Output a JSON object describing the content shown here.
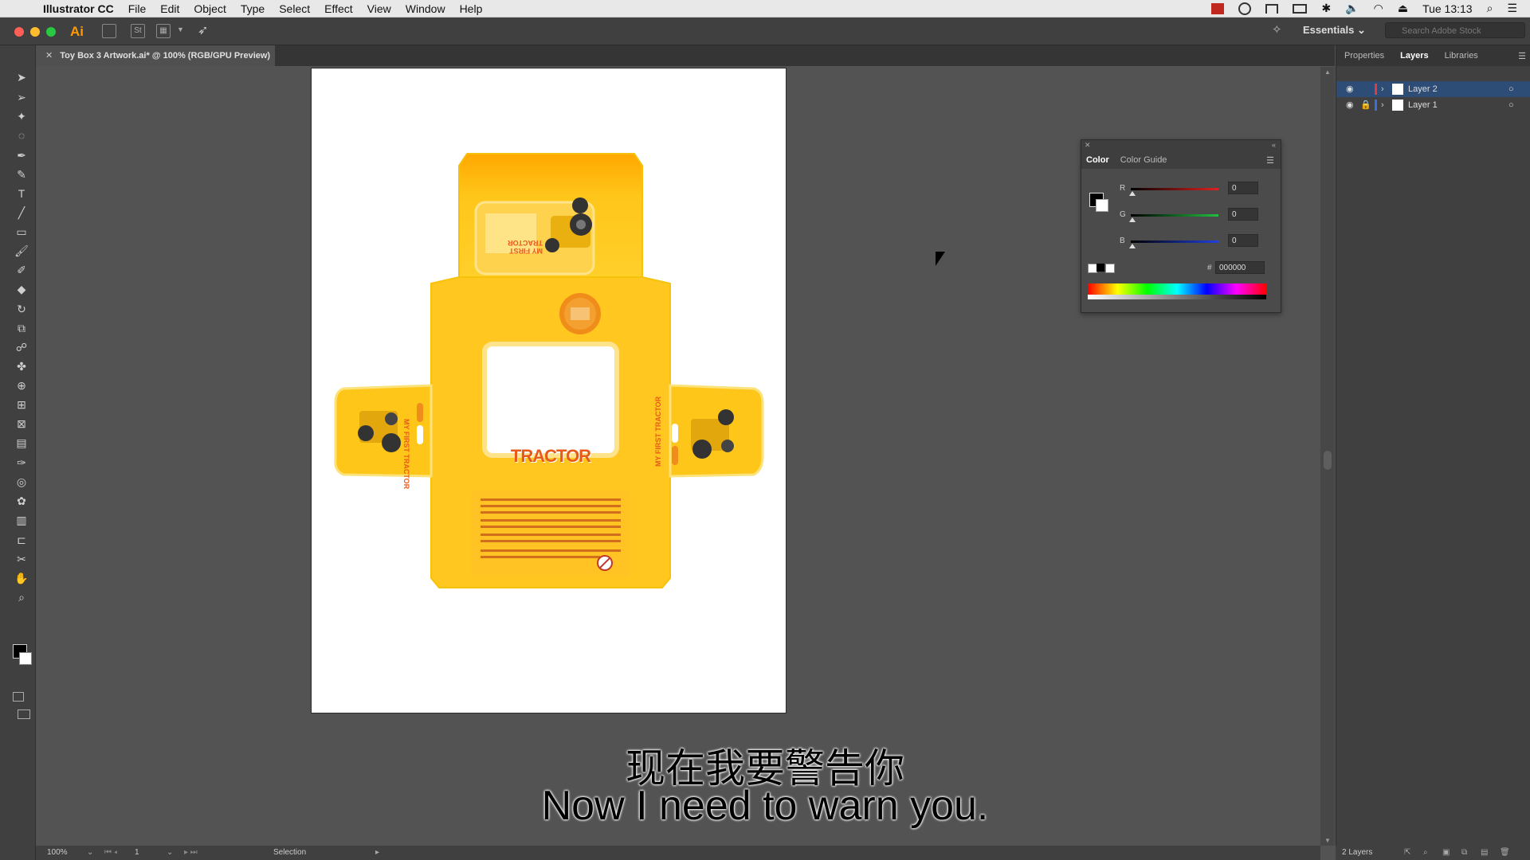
{
  "menubar": {
    "app_name": "Illustrator CC",
    "items": [
      "File",
      "Edit",
      "Object",
      "Type",
      "Select",
      "Effect",
      "View",
      "Window",
      "Help"
    ],
    "clock": "Tue 13:13"
  },
  "appbar": {
    "logo": "Ai",
    "st_label": "St",
    "workspace": "Essentials",
    "search_placeholder": "Search Adobe Stock"
  },
  "document": {
    "tab_title": "Toy Box 3 Artwork.ai* @ 100% (RGB/GPU Preview)"
  },
  "artwork": {
    "product_name": "TRACTOR",
    "side_label_left": "MY FIRST TRACTOR",
    "side_label_right": "MY FIRST TRACTOR",
    "top_label": "MY FIRST TRACTOR"
  },
  "right_panel": {
    "tabs": [
      "Properties",
      "Layers",
      "Libraries"
    ],
    "active_tab": "Layers",
    "layers": [
      "Layer 2",
      "Layer 1"
    ],
    "footer": "2 Layers"
  },
  "color_panel": {
    "tabs": [
      "Color",
      "Color Guide"
    ],
    "sliders": [
      {
        "label": "R",
        "value": "0",
        "color": "#e02020"
      },
      {
        "label": "G",
        "value": "0",
        "color": "#20c040"
      },
      {
        "label": "B",
        "value": "0",
        "color": "#2040e0"
      }
    ],
    "hex_label": "#",
    "hex_value": "000000"
  },
  "status": {
    "zoom": "100%",
    "artboard": "1",
    "tool": "Selection"
  },
  "subtitles": {
    "chinese": "现在我要警告你",
    "english": "Now I need to warn you."
  }
}
